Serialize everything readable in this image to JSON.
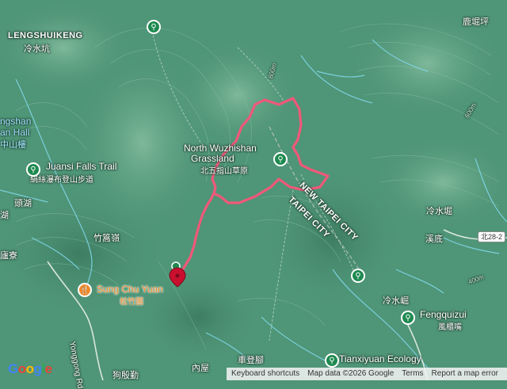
{
  "map": {
    "places": {
      "lengshuikeng_en": "LENGSHUIKENG",
      "lengshuikeng_zh": "冷水坑",
      "lugangping": "鹿堀坪",
      "ngshan": "ngshan",
      "an_hall": "an Hall",
      "zhongshanlou": "中山樓",
      "juansi_falls_en": "Juansi Falls Trail",
      "juansi_falls_zh": "絹絲瀑布登山步道",
      "touhu": "頭湖",
      "hu": "湖",
      "zhuzihu": "竹篙嶺",
      "liaoliao": "廬寮",
      "grassland_en1": "North Wuzhishan",
      "grassland_en2": "Grassland",
      "grassland_zh": "北五指山草原",
      "new_taipei_city": "NEW TAIPEI CITY",
      "taipei_city": "TAIPEI CITY",
      "lengshuijue": "冷水堀",
      "xidi": "溪底",
      "lengshuijue2": "冷水崛",
      "fengquizui_en": "Fengquizui",
      "fengquizui_zh": "風櫃嘴",
      "sung_chu_yuan_en": "Sung Chu Yuan",
      "sung_chu_yuan_zh": "松竹園",
      "yonggong_rd": "Yonggong Rd",
      "chedengjiao": "車登腳",
      "tianxiyuan_en": "Tianxiyuan Ecology",
      "gougouqin": "狗殷勤",
      "neiwu": "內屋",
      "route_shield": "北28-2",
      "contour_400": "400m",
      "contour_600": "600m",
      "contour_800": "800m"
    },
    "attribution": {
      "keyboard_shortcuts": "Keyboard shortcuts",
      "map_data": "Map data ©2026 Google",
      "terms": "Terms",
      "report": "Report a map error"
    },
    "logo": "Google",
    "route_color": "#f0587a",
    "terrain_color": "#4f9577",
    "stream_color": "#7fd6e8"
  }
}
